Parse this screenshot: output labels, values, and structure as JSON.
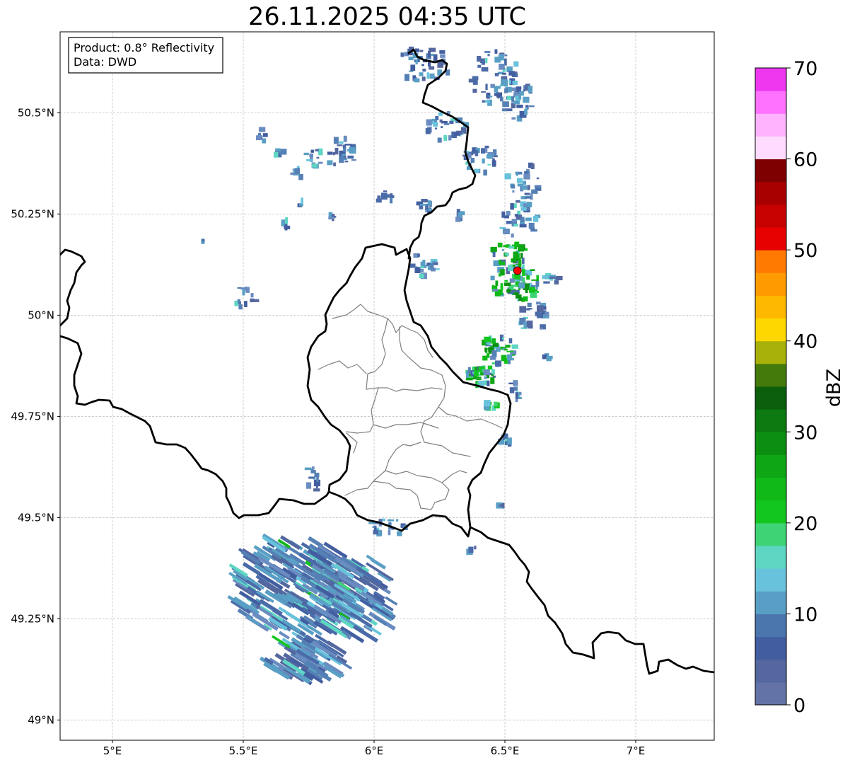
{
  "map": {
    "title": "26.11.2025 04:35 UTC",
    "info_box": {
      "product": "Product: 0.8° Reflectivity",
      "source": "Data: DWD"
    },
    "lon_ticks": [
      {
        "value": 5.0,
        "label": "5°E"
      },
      {
        "value": 5.5,
        "label": "5.5°E"
      },
      {
        "value": 6.0,
        "label": "6°E"
      },
      {
        "value": 6.5,
        "label": "6.5°E"
      },
      {
        "value": 7.0,
        "label": "7°E"
      }
    ],
    "lat_ticks": [
      {
        "value": 50.5,
        "label": "50.5°N"
      },
      {
        "value": 50.25,
        "label": "50.25°N"
      },
      {
        "value": 50.0,
        "label": "50°N"
      },
      {
        "value": 49.75,
        "label": "49.75°N"
      },
      {
        "value": 49.5,
        "label": "49.5°N"
      },
      {
        "value": 49.25,
        "label": "49.25°N"
      },
      {
        "value": 49.0,
        "label": "49°N"
      }
    ],
    "extent": {
      "lon_min": 4.8,
      "lon_max": 7.3,
      "lat_min": 48.95,
      "lat_max": 50.7
    },
    "radar_site": {
      "lon": 6.548,
      "lat": 50.11,
      "color": "#ff0000"
    },
    "colorbar": {
      "label": "dBZ",
      "ticks": [
        "0",
        "10",
        "20",
        "30",
        "40",
        "50",
        "60",
        "70"
      ],
      "min": 0,
      "max": 70,
      "step": 2.5,
      "colors": [
        "#6373a8",
        "#54679f",
        "#435ea0",
        "#4a76ad",
        "#599fc5",
        "#68c2dc",
        "#5fd6c4",
        "#3ed374",
        "#13c61f",
        "#10b818",
        "#0fa615",
        "#0c8f11",
        "#0c7a10",
        "#0b5f0c",
        "#447a0b",
        "#a8b00a",
        "#ffd700",
        "#ffb800",
        "#ff9a00",
        "#ff7a00",
        "#e60000",
        "#c70000",
        "#a80000",
        "#7f0000",
        "#ffdcff",
        "#ffb3ff",
        "#ff71ff",
        "#ee37ef"
      ]
    }
  }
}
